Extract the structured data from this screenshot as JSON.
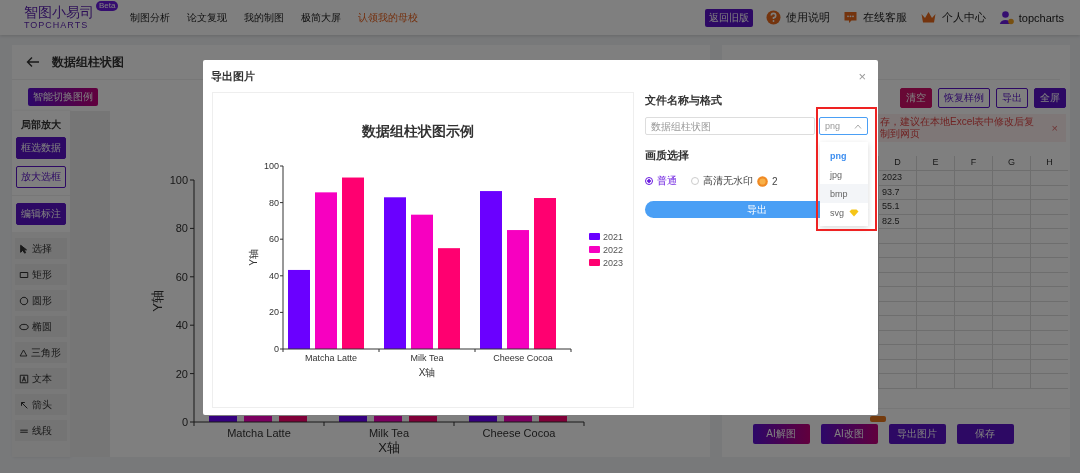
{
  "header": {
    "logo": {
      "name": "智图小易司",
      "subtitle": "TOPCHARTS",
      "badge": "Beta"
    },
    "nav": [
      {
        "label": "制图分析",
        "highlight": false
      },
      {
        "label": "论文复现",
        "highlight": false
      },
      {
        "label": "我的制图",
        "highlight": false
      },
      {
        "label": "极简大屏",
        "highlight": false
      },
      {
        "label": "认领我的母校",
        "highlight": true
      }
    ],
    "old_version_button": "返回旧版",
    "links": [
      {
        "label": "使用说明"
      },
      {
        "label": "在线客服"
      },
      {
        "label": "个人中心"
      },
      {
        "label": "topcharts"
      }
    ]
  },
  "editor": {
    "title": "数据组柱状图",
    "legend_button": "智能切换图例",
    "tools": {
      "section_title": "局部放大",
      "buttons": [
        {
          "label": "框选数据",
          "kind": "filled"
        },
        {
          "label": "放大选框",
          "kind": "outline"
        },
        {
          "label": "编辑标注",
          "kind": "filled"
        }
      ],
      "shapes": [
        "选择",
        "矩形",
        "圆形",
        "椭圆",
        "三角形",
        "文本",
        "箭头",
        "线段"
      ]
    },
    "background_chart": {
      "xlabel": "X轴",
      "ylabel": "Y轴",
      "categories": [
        "Matcha Latte",
        "Milk Tea",
        "Cheese Cocoa"
      ],
      "yticks": [
        "100",
        "80",
        "60",
        "40",
        "20",
        "0"
      ]
    }
  },
  "data_panel": {
    "buttons": [
      {
        "label": "清空",
        "kind": "danger"
      },
      {
        "label": "恢复样例",
        "kind": "outline"
      },
      {
        "label": "导出",
        "kind": "outline"
      },
      {
        "label": "全屏",
        "kind": "primary"
      }
    ],
    "alert": {
      "text": "存，建议在本地Excel表中修改后复制到网页",
      "close": "×"
    },
    "sheet": {
      "columns": [
        "D",
        "E",
        "F",
        "G",
        "H"
      ],
      "rows": [
        "2023",
        "93.7",
        "55.1",
        "82.5"
      ]
    },
    "actions": [
      {
        "label": "AI解图",
        "kind": "gradient",
        "hot": false
      },
      {
        "label": "AI改图",
        "kind": "gradient",
        "hot": true
      },
      {
        "label": "导出图片",
        "kind": "primary",
        "hot": false
      },
      {
        "label": "保存",
        "kind": "primary",
        "hot": false
      }
    ]
  },
  "dialog": {
    "title": "导出图片",
    "close": "×",
    "chart_data": {
      "type": "bar",
      "title": "数据组柱状图示例",
      "xlabel": "X轴",
      "ylabel": "Y轴",
      "legend": "right",
      "categories": [
        "Matcha Latte",
        "Milk Tea",
        "Cheese Cocoa"
      ],
      "ylim": [
        0,
        100
      ],
      "yticks": [
        0,
        20,
        40,
        60,
        80,
        100
      ],
      "series": [
        {
          "name": "2021",
          "color": "#6a00ff",
          "values": [
            43.2,
            82.9,
            86.3
          ]
        },
        {
          "name": "2022",
          "color": "#f700c0",
          "values": [
            85.6,
            73.4,
            65.0
          ]
        },
        {
          "name": "2023",
          "color": "#ff0070",
          "values": [
            93.7,
            55.1,
            82.5
          ]
        }
      ]
    },
    "file_section": "文件名称与格式",
    "filename_placeholder": "数据组柱状图",
    "format": {
      "value": "png",
      "expanded": true,
      "highlighted": true,
      "options": [
        {
          "label": "png",
          "selected": true,
          "hovered": false,
          "premium": false
        },
        {
          "label": "jpg",
          "selected": false,
          "hovered": false,
          "premium": false
        },
        {
          "label": "bmp",
          "selected": false,
          "hovered": true,
          "premium": false
        },
        {
          "label": "svg",
          "selected": false,
          "hovered": false,
          "premium": true
        }
      ]
    },
    "quality_section": "画质选择",
    "quality_options": [
      {
        "label": "普通",
        "selected": true
      },
      {
        "label": "高清无水印",
        "selected": false,
        "cost": "2"
      }
    ],
    "export_button": "导出"
  }
}
